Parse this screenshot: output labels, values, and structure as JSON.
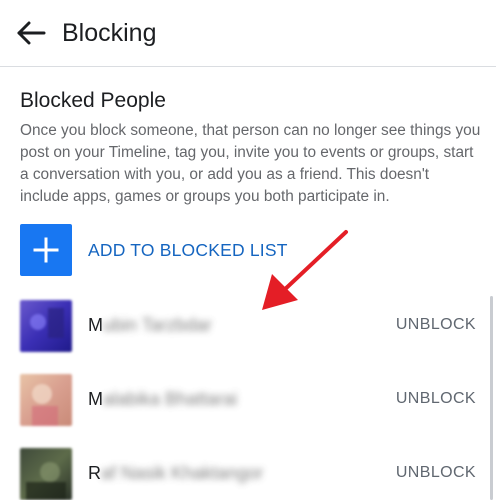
{
  "header": {
    "title": "Blocking"
  },
  "section": {
    "title": "Blocked People",
    "description": "Once you block someone, that person can no longer see things you post on your Timeline, tag you, invite you to events or groups, start a conversation with you, or add you as a friend. This doesn't include apps, games or groups you both participate in."
  },
  "add_button": {
    "label": "ADD TO BLOCKED LIST"
  },
  "blocked_people": [
    {
      "initial": "M",
      "name_rest": "ubin Tarzbdar",
      "action": "UNBLOCK"
    },
    {
      "initial": "M",
      "name_rest": "alabika Bhattarai",
      "action": "UNBLOCK"
    },
    {
      "initial": "R",
      "name_rest": "af Nasik Khaktangor",
      "action": "UNBLOCK"
    }
  ],
  "colors": {
    "accent": "#1877f2",
    "link": "#1565c0",
    "annotation_arrow": "#e41e26"
  }
}
